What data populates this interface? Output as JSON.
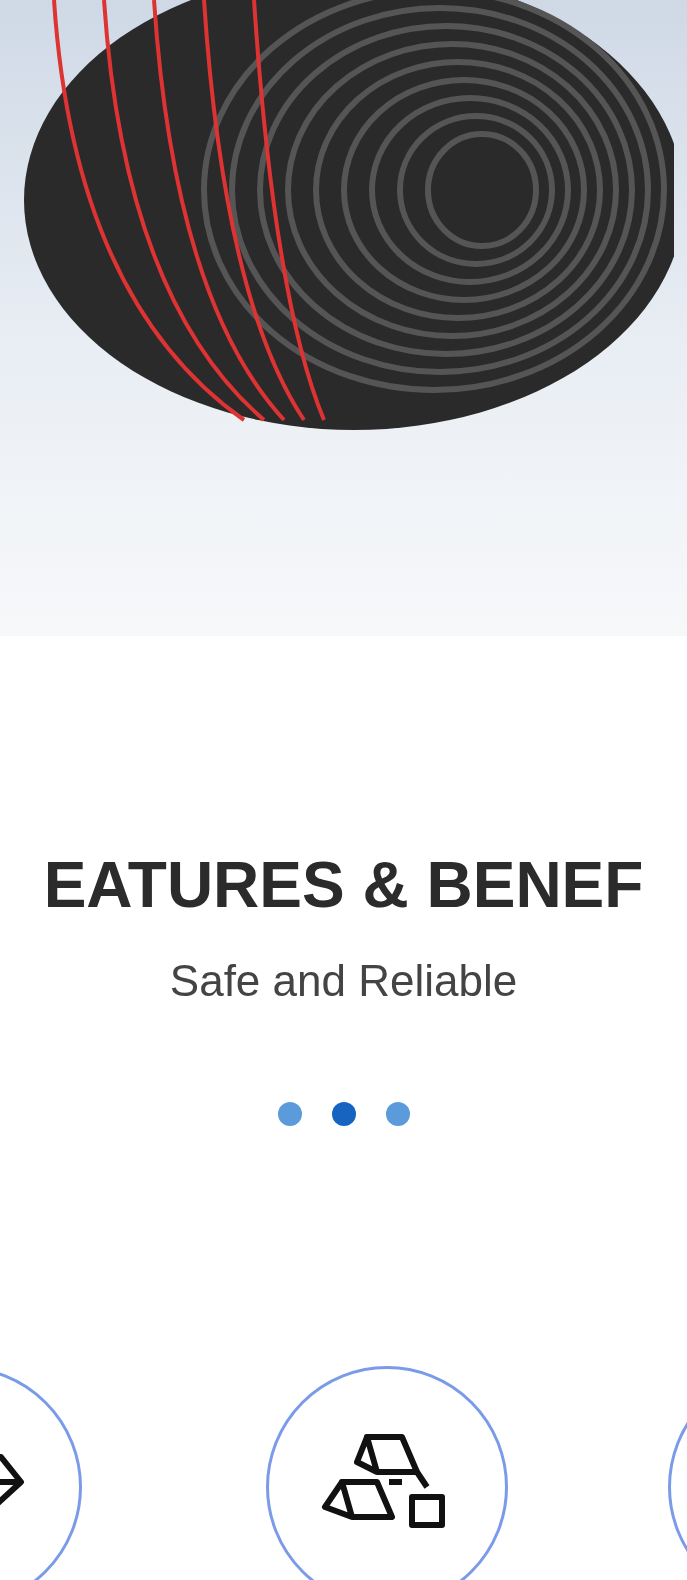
{
  "hero": {
    "kind": "photo"
  },
  "section": {
    "heading": "EATURES & BENEF",
    "subtitle": "Safe and Reliable"
  },
  "carousel_dots": [
    {
      "selected": false
    },
    {
      "selected": true
    },
    {
      "selected": false
    }
  ],
  "features": [
    {
      "kind": "diamond"
    },
    {
      "kind": "ingots"
    },
    {
      "kind": "blank"
    }
  ]
}
